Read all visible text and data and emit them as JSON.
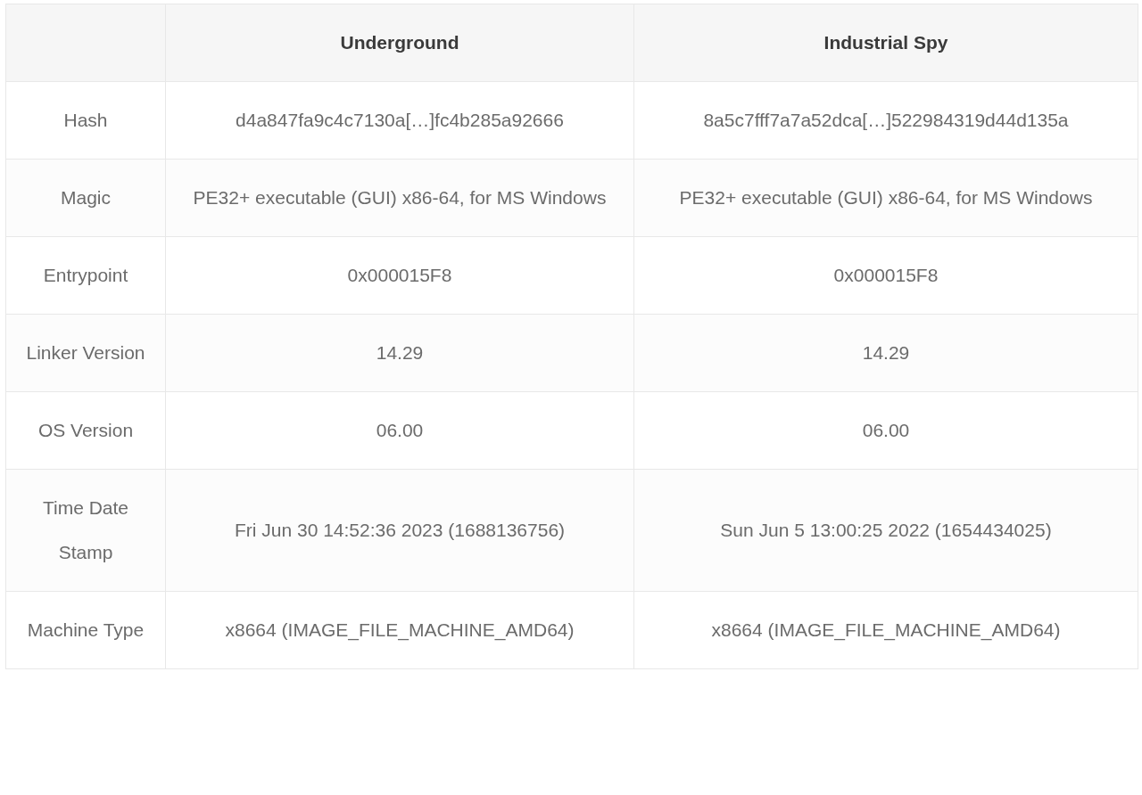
{
  "table": {
    "columns": [
      "Underground",
      "Industrial Spy"
    ],
    "rows": [
      {
        "label": "Hash",
        "cells": [
          "d4a847fa9c4c7130a[…]fc4b285a92666",
          "8a5c7fff7a7a52dca[…]522984319d44d135a"
        ]
      },
      {
        "label": "Magic",
        "cells": [
          "PE32+ executable (GUI) x86-64, for MS Windows",
          "PE32+ executable (GUI) x86-64, for MS Windows"
        ]
      },
      {
        "label": "Entrypoint",
        "cells": [
          "0x000015F8",
          "0x000015F8"
        ]
      },
      {
        "label": "Linker Version",
        "cells": [
          "14.29",
          "14.29"
        ]
      },
      {
        "label": "OS Version",
        "cells": [
          "06.00",
          "06.00"
        ]
      },
      {
        "label": "Time Date Stamp",
        "cells": [
          "Fri Jun 30 14:52:36 2023 (1688136756)",
          "Sun Jun 5 13:00:25 2022 (1654434025)"
        ]
      },
      {
        "label": "Machine Type",
        "cells": [
          "x8664 (IMAGE_FILE_MACHINE_AMD64)",
          "x8664 (IMAGE_FILE_MACHINE_AMD64)"
        ]
      }
    ]
  }
}
